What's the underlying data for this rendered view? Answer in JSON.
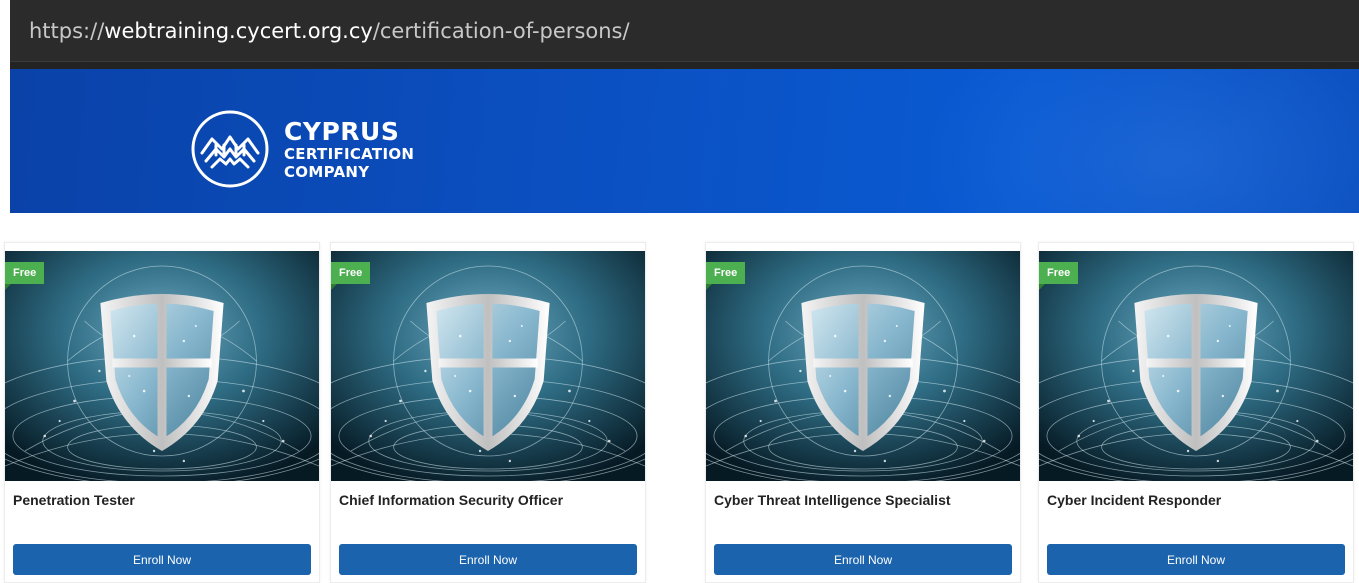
{
  "browser": {
    "url_scheme": "https://",
    "url_host": "webtraining.cycert.org.cy",
    "url_path": "/certification-of-persons/"
  },
  "header": {
    "logo_line1": "CYPRUS",
    "logo_line2": "CERTIFICATION",
    "logo_line3": "COMPANY",
    "colors": {
      "banner": "#0b4fc0",
      "urlbar": "#2b2b2b"
    }
  },
  "courses": [
    {
      "badge": "Free",
      "title": "Penetration Tester",
      "button": "Enroll Now"
    },
    {
      "badge": "Free",
      "title": "Chief Information Security Officer",
      "button": "Enroll Now"
    },
    {
      "badge": "Free",
      "title": "Cyber Threat Intelligence Specialist",
      "button": "Enroll Now"
    },
    {
      "badge": "Free",
      "title": "Cyber Incident Responder",
      "button": "Enroll Now"
    }
  ],
  "colors": {
    "badge": "#4caf50",
    "button": "#1b63ad"
  },
  "icons": [
    "cycert-logo-icon",
    "shield-icon"
  ]
}
